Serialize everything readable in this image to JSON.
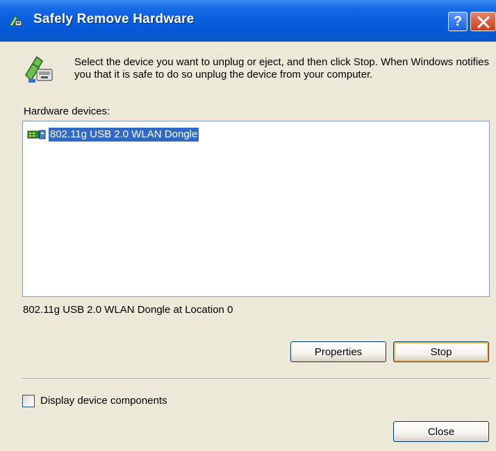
{
  "window": {
    "title": "Safely Remove Hardware",
    "title_icon": "safely-remove-hardware-icon",
    "help_label": "?",
    "colors": {
      "titlebar": "#0a5fdc",
      "face": "#ece9d8",
      "selection": "#316ac5",
      "close_button": "#c6401c"
    }
  },
  "intro": {
    "icon": "eject-device-icon",
    "text": "Select the device you want to unplug or eject, and then click Stop. When Windows notifies you that it is safe to do so unplug the device from your computer."
  },
  "devices": {
    "label": "Hardware devices:",
    "items": [
      {
        "icon": "usb-network-adapter-icon",
        "label": "802.11g USB 2.0 WLAN Dongle",
        "selected": true
      }
    ],
    "selected_location": "802.11g USB 2.0 WLAN Dongle at Location 0"
  },
  "buttons": {
    "properties": "Properties",
    "stop": "Stop",
    "close": "Close"
  },
  "options": {
    "display_components_label": "Display device components",
    "display_components_checked": false
  }
}
